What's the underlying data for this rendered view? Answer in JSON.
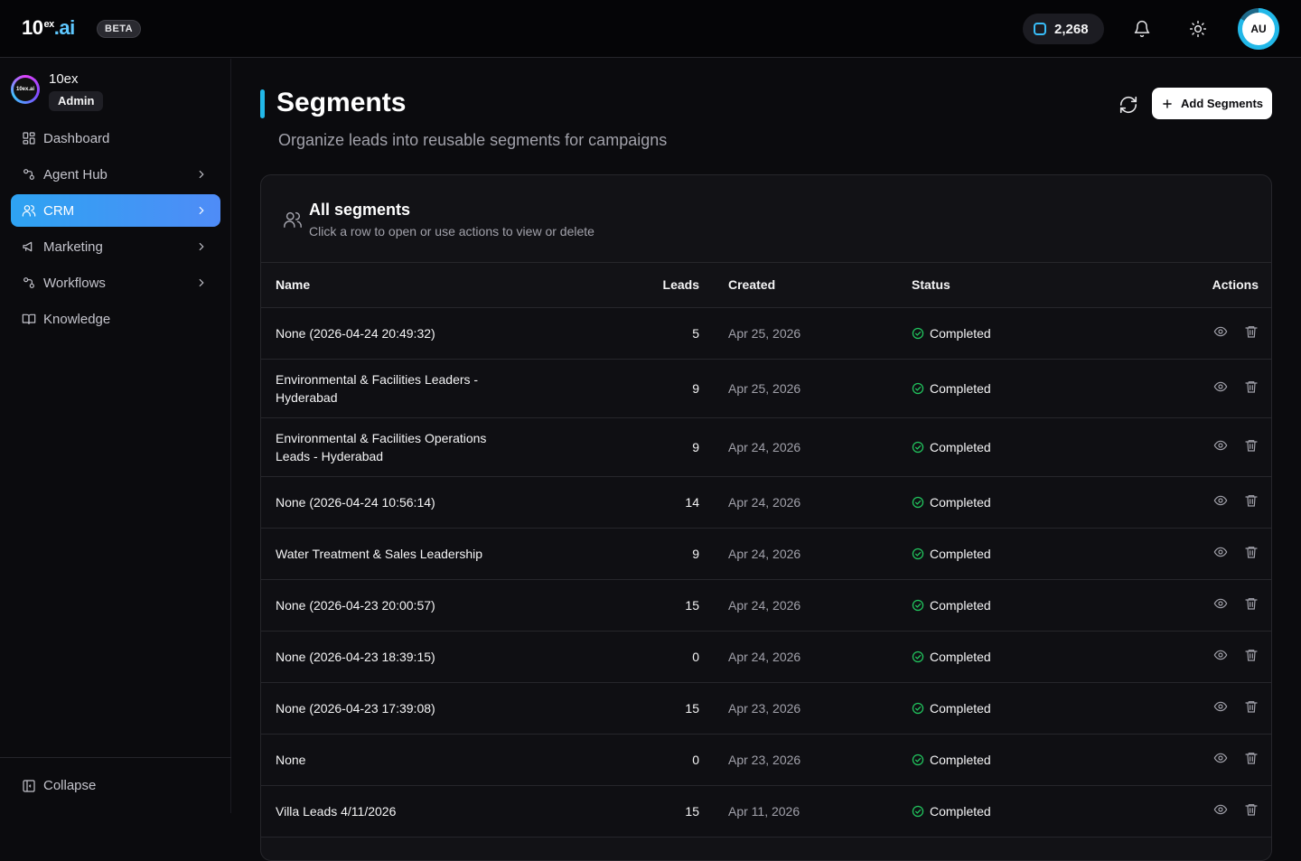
{
  "brand": {
    "logo_main": "10",
    "logo_sup": "ex",
    "logo_suffix": ".ai",
    "badge": "BETA",
    "accent": "#22b8e8"
  },
  "topbar": {
    "credits": "2,268",
    "avatar_initials": "AU"
  },
  "sidebar": {
    "org_name": "10ex",
    "org_logo_text": "10ex.ai",
    "org_role": "Admin",
    "items": [
      {
        "label": "Dashboard",
        "icon": "grid-icon"
      },
      {
        "label": "Agent Hub",
        "icon": "agent-icon"
      },
      {
        "label": "CRM",
        "icon": "users-icon"
      },
      {
        "label": "Marketing",
        "icon": "megaphone-icon"
      },
      {
        "label": "Workflows",
        "icon": "workflow-icon"
      },
      {
        "label": "Knowledge",
        "icon": "book-icon"
      }
    ],
    "collapse_label": "Collapse"
  },
  "page": {
    "title": "Segments",
    "subtitle": "Organize leads into reusable segments for campaigns",
    "add_button": "Add Segments"
  },
  "card": {
    "title": "All segments",
    "subtitle": "Click a row to open or use actions to view or delete"
  },
  "table": {
    "headers": {
      "name": "Name",
      "leads": "Leads",
      "created": "Created",
      "status": "Status",
      "actions": "Actions"
    },
    "rows": [
      {
        "name": "None (2026-04-24 20:49:32)",
        "leads": "5",
        "created": "Apr 25, 2026",
        "status": "Completed"
      },
      {
        "name": "Environmental & Facilities Leaders - Hyderabad",
        "leads": "9",
        "created": "Apr 25, 2026",
        "status": "Completed"
      },
      {
        "name": "Environmental & Facilities Operations Leads - Hyderabad",
        "leads": "9",
        "created": "Apr 24, 2026",
        "status": "Completed"
      },
      {
        "name": "None (2026-04-24 10:56:14)",
        "leads": "14",
        "created": "Apr 24, 2026",
        "status": "Completed"
      },
      {
        "name": "Water Treatment & Sales Leadership",
        "leads": "9",
        "created": "Apr 24, 2026",
        "status": "Completed"
      },
      {
        "name": "None (2026-04-23 20:00:57)",
        "leads": "15",
        "created": "Apr 24, 2026",
        "status": "Completed"
      },
      {
        "name": "None (2026-04-23 18:39:15)",
        "leads": "0",
        "created": "Apr 24, 2026",
        "status": "Completed"
      },
      {
        "name": "None (2026-04-23 17:39:08)",
        "leads": "15",
        "created": "Apr 23, 2026",
        "status": "Completed"
      },
      {
        "name": "None",
        "leads": "0",
        "created": "Apr 23, 2026",
        "status": "Completed"
      },
      {
        "name": "Villa Leads 4/11/2026",
        "leads": "15",
        "created": "Apr 11, 2026",
        "status": "Completed"
      }
    ]
  },
  "colors": {
    "status_ok": "#22c55e",
    "active_nav": "#2ea3f2"
  }
}
